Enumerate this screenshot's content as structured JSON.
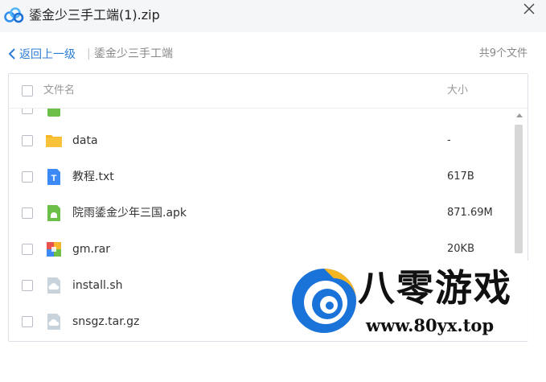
{
  "window": {
    "title": "鋈金少三手工端(1).zip",
    "app_icon": "cloud-logo-icon",
    "close_icon": "close-icon"
  },
  "nav": {
    "back_label": "返回上一级",
    "separator": "|",
    "current_folder": "鋈金少三手工端",
    "file_count": "共9个文件"
  },
  "table": {
    "col_name": "文件名",
    "col_size": "大小"
  },
  "files": [
    {
      "name": "",
      "size": "",
      "icon": "apk-file-icon"
    },
    {
      "name": "data",
      "size": "-",
      "icon": "folder-icon"
    },
    {
      "name": "教程.txt",
      "size": "617B",
      "icon": "text-file-icon"
    },
    {
      "name": "院雨鋈金少年三国.apk",
      "size": "871.69M",
      "icon": "apk-file-icon"
    },
    {
      "name": "gm.rar",
      "size": "20KB",
      "icon": "archive-file-icon"
    },
    {
      "name": "install.sh",
      "size": "",
      "icon": "generic-file-icon"
    },
    {
      "name": "snsgz.tar.gz",
      "size": "",
      "icon": "generic-file-icon"
    }
  ],
  "watermark": {
    "brand": "八零游戏",
    "url": "www.80yx.top"
  },
  "colors": {
    "accent": "#2b7cd3",
    "folder": "#f5b622",
    "txt": "#3d8af7",
    "apk": "#6cc04a",
    "generic": "#c9d3dc"
  }
}
